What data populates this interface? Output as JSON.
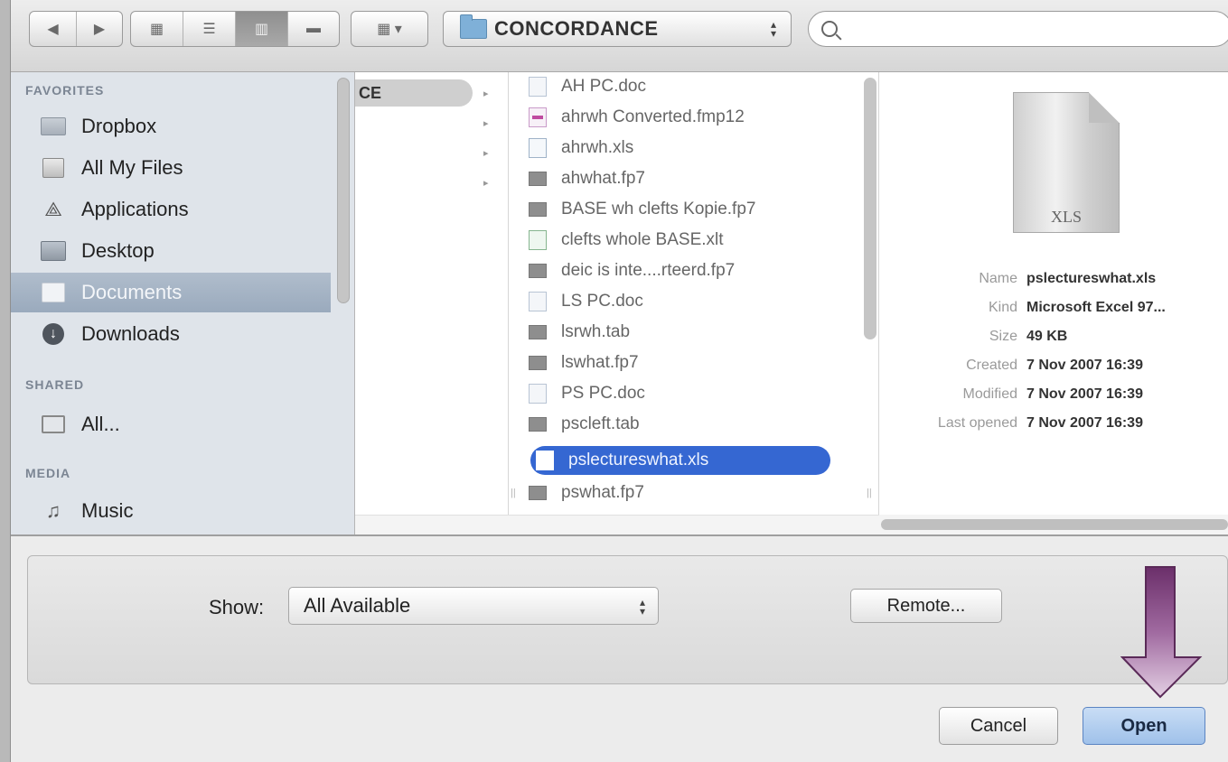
{
  "toolbar": {
    "path_label": "CONCORDANCE",
    "search_value": "",
    "view_modes": [
      "icon-view",
      "list-view",
      "column-view",
      "coverflow-view"
    ],
    "active_view": "column-view"
  },
  "sidebar": {
    "sections": [
      {
        "heading": "FAVORITES",
        "items": [
          {
            "label": "Dropbox",
            "icon": "folder-icon"
          },
          {
            "label": "All My Files",
            "icon": "all-files-icon"
          },
          {
            "label": "Applications",
            "icon": "applications-icon"
          },
          {
            "label": "Desktop",
            "icon": "desktop-icon"
          },
          {
            "label": "Documents",
            "icon": "documents-icon",
            "selected": true
          },
          {
            "label": "Downloads",
            "icon": "downloads-icon"
          }
        ]
      },
      {
        "heading": "SHARED",
        "items": [
          {
            "label": "All...",
            "icon": "network-icon"
          }
        ]
      },
      {
        "heading": "MEDIA",
        "items": [
          {
            "label": "Music",
            "icon": "music-icon"
          }
        ]
      }
    ]
  },
  "column1": {
    "selected_item": "CE"
  },
  "files": [
    {
      "name": "AH PC.doc",
      "icon": "doc"
    },
    {
      "name": "ahrwh Converted.fmp12",
      "icon": "fmp"
    },
    {
      "name": "ahrwh.xls",
      "icon": "xls"
    },
    {
      "name": "ahwhat.fp7",
      "icon": "bin"
    },
    {
      "name": "BASE wh clefts Kopie.fp7",
      "icon": "bin"
    },
    {
      "name": "clefts whole BASE.xlt",
      "icon": "xlt"
    },
    {
      "name": "deic is inte....rteerd.fp7",
      "icon": "bin"
    },
    {
      "name": "LS PC.doc",
      "icon": "doc"
    },
    {
      "name": "lsrwh.tab",
      "icon": "bin"
    },
    {
      "name": "lswhat.fp7",
      "icon": "bin"
    },
    {
      "name": "PS PC.doc",
      "icon": "doc"
    },
    {
      "name": "pscleft.tab",
      "icon": "bin"
    },
    {
      "name": "pslectureswhat.xls",
      "icon": "xls",
      "selected": true
    },
    {
      "name": "pswhat.fp7",
      "icon": "bin"
    }
  ],
  "preview": {
    "extension": "XLS",
    "meta": [
      {
        "key": "Name",
        "value": "pslectureswhat.xls"
      },
      {
        "key": "Kind",
        "value": "Microsoft Excel 97..."
      },
      {
        "key": "Size",
        "value": "49 KB"
      },
      {
        "key": "Created",
        "value": "7 Nov 2007 16:39"
      },
      {
        "key": "Modified",
        "value": "7 Nov 2007 16:39"
      },
      {
        "key": "Last opened",
        "value": "7 Nov 2007 16:39"
      }
    ]
  },
  "options": {
    "show_label": "Show:",
    "show_value": "All Available",
    "remote_label": "Remote..."
  },
  "buttons": {
    "cancel": "Cancel",
    "open": "Open"
  },
  "colors": {
    "selection": "#3567d2",
    "arrow": "#7a3f78"
  }
}
